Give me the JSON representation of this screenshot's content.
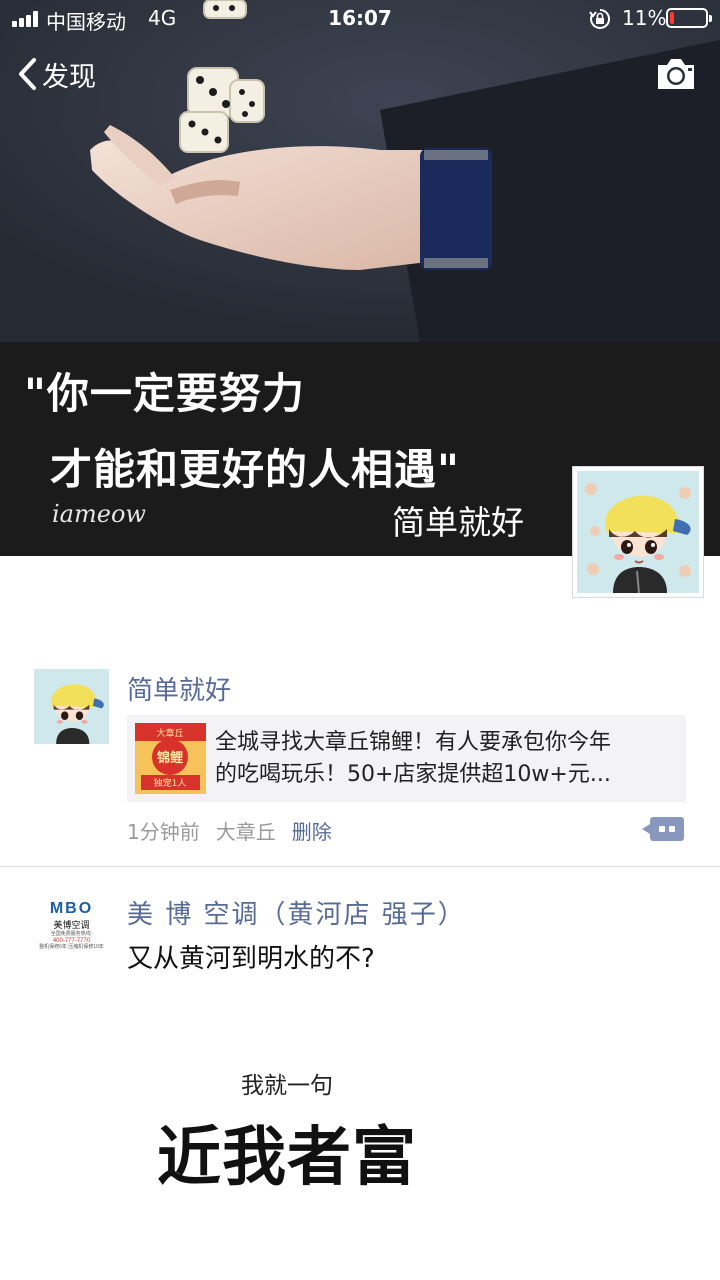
{
  "status_bar": {
    "carrier": "中国移动",
    "network": "4G",
    "time": "16:07",
    "battery_percent": "11%",
    "battery_level": 0.11,
    "battery_color": "#ff3b30"
  },
  "nav": {
    "back_label": "发现",
    "back_icon": "chevron-left-icon",
    "camera_icon": "camera-icon"
  },
  "cover": {
    "quote_line1": "\"你一定要努力",
    "quote_line2": "才能和更好的人相遇\"",
    "signature": "iameow",
    "user_name": "简单就好"
  },
  "posts": [
    {
      "author": "简单就好",
      "shared_card": {
        "line1": "全城寻找大章丘锦鲤！有人要承包你今年",
        "line2": "的吃喝玩乐！50+店家提供超10w+元...",
        "thumb_top": "大章丘",
        "thumb_mid": "锦鲤",
        "thumb_bottom": "独宠1人"
      },
      "time": "1分钟前",
      "location": "大章丘",
      "delete_label": "删除",
      "comment_icon": "comment-bubble-icon"
    },
    {
      "author": "美 博 空调（黄河店 强子）",
      "avatar_logo": {
        "title": "MBO",
        "subtitle": "美博空调",
        "tagline": "全国免费服务热线:",
        "phone": "400-777-7770",
        "note": "整机保修6年 压缩机保修10年"
      },
      "text": "又从黄河到明水的不?",
      "meme": {
        "small": "我就一句",
        "big": "近我者富"
      }
    }
  ],
  "colors": {
    "link": "#576b95",
    "meta": "#9a9a9a",
    "card_bg": "#f3f3f5"
  }
}
